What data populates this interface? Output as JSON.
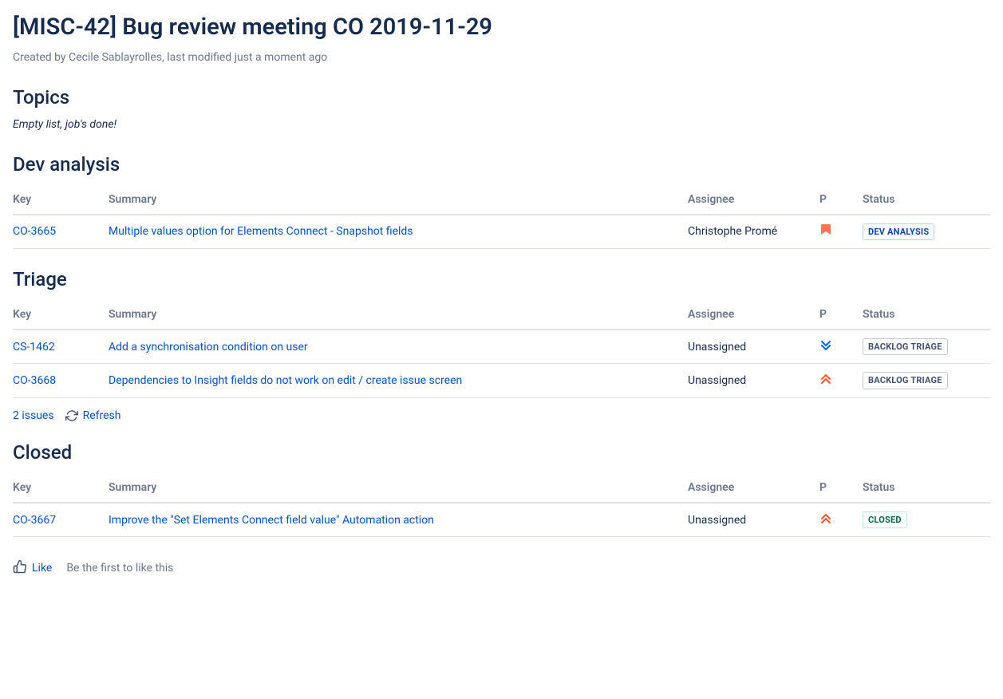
{
  "page": {
    "title": "[MISC-42] Bug review meeting CO 2019-11-29",
    "meta_created": "Created by ",
    "meta_author": "Cecile Sablayrolles",
    "meta_mid": ", last modified ",
    "meta_modified": "just a moment ago"
  },
  "topics": {
    "heading": "Topics",
    "text": "Empty list, job's done!"
  },
  "dev_analysis": {
    "heading": "Dev analysis",
    "headers": {
      "key": "Key",
      "summary": "Summary",
      "assignee": "Assignee",
      "priority": "P",
      "status": "Status"
    },
    "rows": [
      {
        "key": "CO-3665",
        "summary": "Multiple values option for Elements Connect - Snapshot fields",
        "assignee": "Christophe Promé",
        "priority": "high",
        "status": "DEV ANALYSIS",
        "status_style": "blue"
      }
    ]
  },
  "triage": {
    "heading": "Triage",
    "headers": {
      "key": "Key",
      "summary": "Summary",
      "assignee": "Assignee",
      "priority": "P",
      "status": "Status"
    },
    "rows": [
      {
        "key": "CS-1462",
        "summary": "Add a synchronisation condition on user",
        "assignee": "Unassigned",
        "priority": "low",
        "status": "BACKLOG TRIAGE",
        "status_style": "gray"
      },
      {
        "key": "CO-3668",
        "summary": "Dependencies to Insight fields do not work on edit / create issue screen",
        "assignee": "Unassigned",
        "priority": "highest",
        "status": "BACKLOG TRIAGE",
        "status_style": "gray"
      }
    ],
    "footer": {
      "count": "2 issues",
      "refresh": "Refresh"
    }
  },
  "closed": {
    "heading": "Closed",
    "headers": {
      "key": "Key",
      "summary": "Summary",
      "assignee": "Assignee",
      "priority": "P",
      "status": "Status"
    },
    "rows": [
      {
        "key": "CO-3667",
        "summary": "Improve the \"Set Elements Connect field value\" Automation action",
        "assignee": "Unassigned",
        "priority": "highest",
        "status": "CLOSED",
        "status_style": "green"
      }
    ]
  },
  "like": {
    "label": "Like",
    "prompt": "Be the first to like this"
  }
}
